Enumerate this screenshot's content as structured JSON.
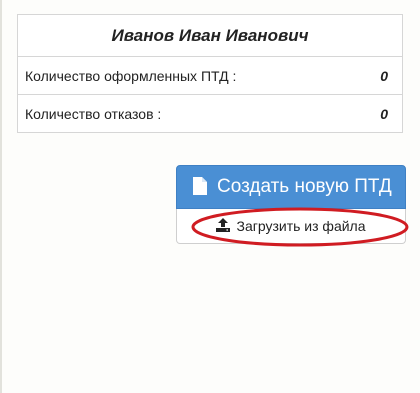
{
  "profile": {
    "name": "Иванов Иван Иванович"
  },
  "stats": [
    {
      "label": "Количество оформленных ПТД :",
      "value": "0"
    },
    {
      "label": "Количество отказов :",
      "value": "0"
    }
  ],
  "actions": {
    "create_label": "Создать новую ПТД",
    "create_icon": "file-icon",
    "upload_label": "Загрузить из файла",
    "upload_icon": "upload-icon"
  },
  "colors": {
    "primary": "#4a8fd4",
    "annotation": "#d01c22"
  }
}
